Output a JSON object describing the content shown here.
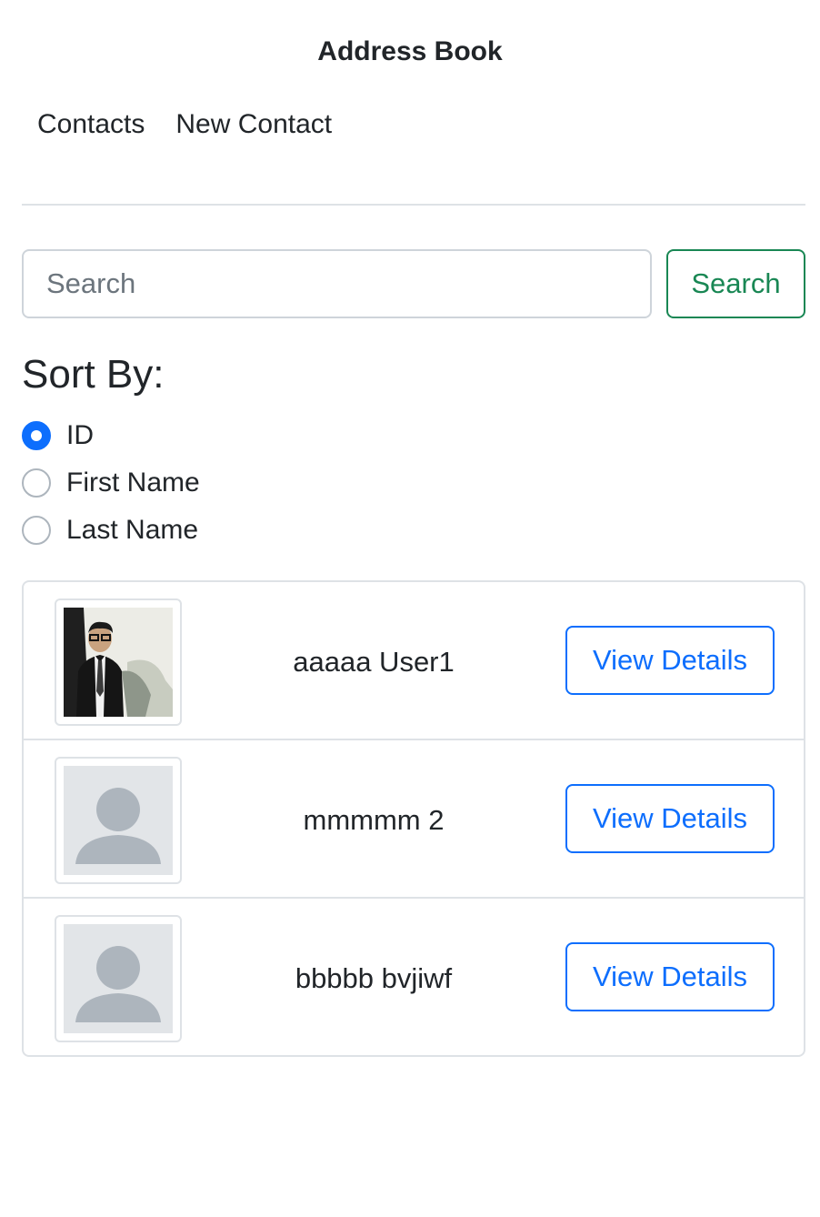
{
  "header": {
    "title": "Address Book"
  },
  "nav": {
    "contacts": "Contacts",
    "new_contact": "New Contact"
  },
  "search": {
    "placeholder": "Search",
    "value": "",
    "button_label": "Search"
  },
  "sort": {
    "heading": "Sort By:",
    "options": [
      {
        "label": "ID",
        "checked": true
      },
      {
        "label": "First Name",
        "checked": false
      },
      {
        "label": "Last Name",
        "checked": false
      }
    ]
  },
  "contacts": [
    {
      "name": "aaaaa User1",
      "avatar": "photo",
      "button_label": "View Details"
    },
    {
      "name": "mmmmm 2",
      "avatar": "default-avatar-icon",
      "button_label": "View Details"
    },
    {
      "name": "bbbbb bvjiwf",
      "avatar": "default-avatar-icon",
      "button_label": "View Details"
    }
  ],
  "colors": {
    "primary": "#0d6efd",
    "success": "#198754",
    "border": "#dee2e6",
    "placeholder": "#6c757d"
  }
}
